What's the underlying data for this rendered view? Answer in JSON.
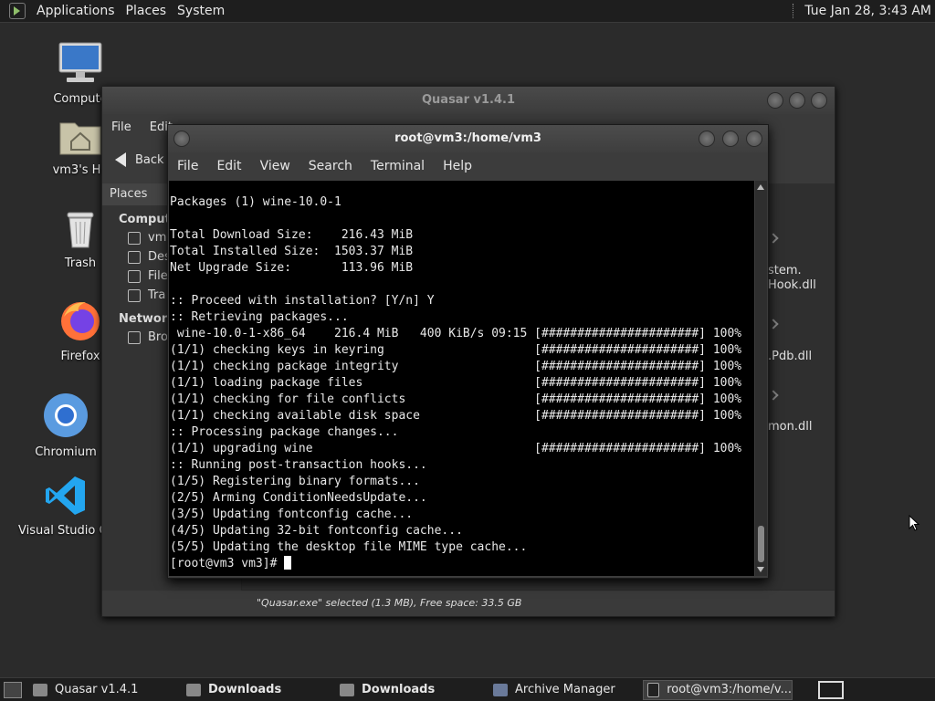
{
  "top_panel": {
    "menus": [
      "Applications",
      "Places",
      "System"
    ],
    "clock": "Tue Jan 28,  3:43 AM"
  },
  "desktop_icons": [
    "Compute",
    "vm3's Ho",
    "Trash",
    "Firefox",
    "Chromium",
    "Visual Studio Co"
  ],
  "file_manager": {
    "title": "Quasar v1.4.1",
    "menu": [
      "File",
      "Edit"
    ],
    "back_label": "Back",
    "sidebar_header": "Places",
    "sections": [
      "Compute",
      "Network"
    ],
    "sidebar_items": [
      "vm",
      "Des",
      "File",
      "Tra",
      "Bro"
    ],
    "files": [
      "stem.",
      "Hook.dll",
      ".Pdb.dll",
      "mon.dll"
    ],
    "status": "\"Quasar.exe\" selected (1.3 MB), Free space: 33.5 GB"
  },
  "terminal": {
    "title": "root@vm3:/home/vm3",
    "menu": [
      "File",
      "Edit",
      "View",
      "Search",
      "Terminal",
      "Help"
    ],
    "lines": [
      "Packages (1) wine-10.0-1",
      "",
      "Total Download Size:    216.43 MiB",
      "Total Installed Size:  1503.37 MiB",
      "Net Upgrade Size:       113.96 MiB",
      "",
      ":: Proceed with installation? [Y/n] Y",
      ":: Retrieving packages...",
      " wine-10.0-1-x86_64    216.4 MiB   400 KiB/s 09:15 [######################] 100%",
      "(1/1) checking keys in keyring                     [######################] 100%",
      "(1/1) checking package integrity                   [######################] 100%",
      "(1/1) loading package files                        [######################] 100%",
      "(1/1) checking for file conflicts                  [######################] 100%",
      "(1/1) checking available disk space                [######################] 100%",
      ":: Processing package changes...",
      "(1/1) upgrading wine                               [######################] 100%",
      ":: Running post-transaction hooks...",
      "(1/5) Registering binary formats...",
      "(2/5) Arming ConditionNeedsUpdate...",
      "(3/5) Updating fontconfig cache...",
      "(4/5) Updating 32-bit fontconfig cache...",
      "(5/5) Updating the desktop file MIME type cache..."
    ],
    "prompt": "[root@vm3 vm3]# "
  },
  "taskbar": {
    "tasks": [
      "Quasar v1.4.1",
      "Downloads",
      "Downloads",
      "Archive Manager",
      "root@vm3:/home/v..."
    ]
  }
}
